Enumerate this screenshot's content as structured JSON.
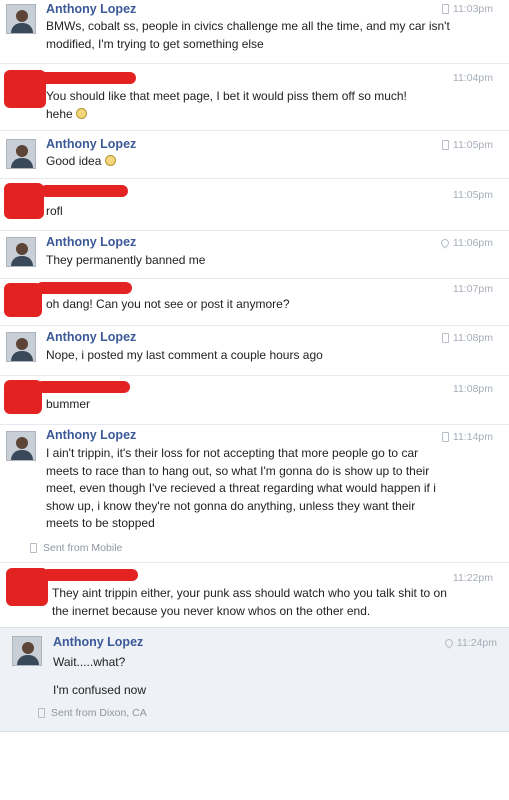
{
  "messages": [
    {
      "name": "Anthony Lopez",
      "time": "11:03pm",
      "device": "phone",
      "text": "BMWs, cobalt ss, people in civics challenge me all the time, and my car isn't modified, I'm trying to get something else"
    },
    {
      "name": "",
      "time": "11:04pm",
      "device": "",
      "text": "You should like that meet page, I bet it would piss them off so much!\nhehe",
      "emoji": "smiley"
    },
    {
      "name": "Anthony Lopez",
      "time": "11:05pm",
      "device": "phone",
      "text": "Good idea",
      "emoji": "smiley"
    },
    {
      "name": "",
      "time": "11:05pm",
      "device": "",
      "text": "rofl"
    },
    {
      "name": "Anthony Lopez",
      "time": "11:06pm",
      "device": "location",
      "text": "They permanently banned me"
    },
    {
      "name": "",
      "time": "11:07pm",
      "device": "",
      "text": "oh dang! Can you not see or post it anymore?"
    },
    {
      "name": "Anthony Lopez",
      "time": "11:08pm",
      "device": "phone",
      "text": "Nope, i posted my last comment a couple hours ago"
    },
    {
      "name": "",
      "time": "11:08pm",
      "device": "",
      "text": "bummer"
    },
    {
      "name": "Anthony Lopez",
      "time": "11:14pm",
      "device": "phone",
      "text": "I ain't trippin, it's their loss for not accepting that more people go to car meets to race than to hang out, so what I'm gonna do is show up to their meet, even though I've recieved a threat regarding what would happen if i show up, i know they're not gonna do anything, unless they want their meets to be stopped"
    },
    {
      "name": "",
      "time": "11:22pm",
      "device": "",
      "text": "They aint trippin either, your punk ass should watch who you talk shit to on the inernet because you never know whos on the other end."
    },
    {
      "name": "Anthony Lopez",
      "time": "11:24pm",
      "device": "location",
      "text": "Wait.....what?",
      "text2": "I'm confused now"
    }
  ],
  "sent_mobile": "Sent from Mobile",
  "sent_dixon": "Sent from Dixon, CA",
  "colors": {
    "name": "#3b5998",
    "redaction": "#e32222",
    "time": "#a5adb8",
    "highlight": "#eef1f6"
  }
}
